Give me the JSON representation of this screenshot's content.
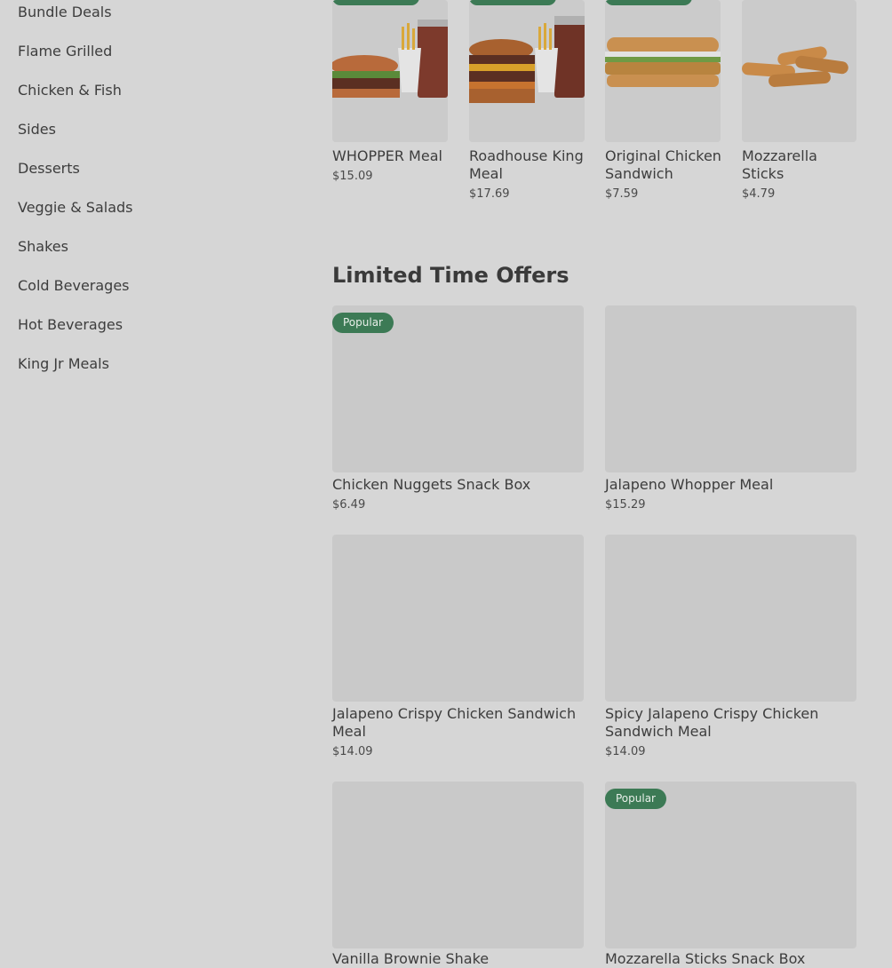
{
  "sidebar": {
    "categories": [
      "Bundle Deals",
      "Flame Grilled",
      "Chicken & Fish",
      "Sides",
      "Desserts",
      "Veggie & Salads",
      "Shakes",
      "Cold Beverages",
      "Hot Beverages",
      "King Jr Meals"
    ]
  },
  "featured": {
    "items": [
      {
        "name": "WHOPPER Meal",
        "price": "$15.09",
        "image": "whopper-meal-image"
      },
      {
        "name": "Roadhouse King Meal",
        "price": "$17.69",
        "image": "roadhouse-king-meal-image"
      },
      {
        "name": "Original Chicken Sandwich",
        "price": "$7.59",
        "image": "original-chicken-sandwich-image"
      },
      {
        "name": "Mozzarella Sticks",
        "price": "$4.79",
        "image": "mozzarella-sticks-image"
      }
    ]
  },
  "limited": {
    "title": "Limited Time Offers",
    "badge_label": "Popular",
    "items": [
      {
        "name": "Chicken Nuggets Snack Box",
        "price": "$6.49",
        "badge": "Popular"
      },
      {
        "name": "Jalapeno Whopper Meal",
        "price": "$15.29",
        "badge": ""
      },
      {
        "name": "Jalapeno Crispy Chicken Sandwich Meal",
        "price": "$14.09",
        "badge": ""
      },
      {
        "name": "Spicy Jalapeno Crispy Chicken Sandwich Meal",
        "price": "$14.09",
        "badge": ""
      },
      {
        "name": "Vanilla Brownie Shake",
        "price": "",
        "badge": ""
      },
      {
        "name": "Mozzarella Sticks Snack Box",
        "price": "",
        "badge": "Popular"
      }
    ]
  },
  "colors": {
    "overlay_bg": "#d6d6d6",
    "badge_green": "#3c7a55",
    "tile_grey": "#c9c9c9"
  }
}
